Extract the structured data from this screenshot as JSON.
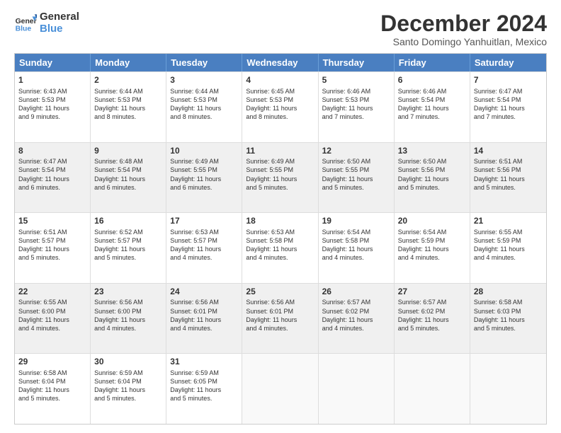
{
  "logo": {
    "line1": "General",
    "line2": "Blue"
  },
  "title": "December 2024",
  "subtitle": "Santo Domingo Yanhuitlan, Mexico",
  "days": [
    "Sunday",
    "Monday",
    "Tuesday",
    "Wednesday",
    "Thursday",
    "Friday",
    "Saturday"
  ],
  "rows": [
    [
      {
        "num": "1",
        "rise": "6:43 AM",
        "set": "5:53 PM",
        "daylight": "11 hours and 9 minutes."
      },
      {
        "num": "2",
        "rise": "6:44 AM",
        "set": "5:53 PM",
        "daylight": "11 hours and 8 minutes."
      },
      {
        "num": "3",
        "rise": "6:44 AM",
        "set": "5:53 PM",
        "daylight": "11 hours and 8 minutes."
      },
      {
        "num": "4",
        "rise": "6:45 AM",
        "set": "5:53 PM",
        "daylight": "11 hours and 8 minutes."
      },
      {
        "num": "5",
        "rise": "6:46 AM",
        "set": "5:53 PM",
        "daylight": "11 hours and 7 minutes."
      },
      {
        "num": "6",
        "rise": "6:46 AM",
        "set": "5:54 PM",
        "daylight": "11 hours and 7 minutes."
      },
      {
        "num": "7",
        "rise": "6:47 AM",
        "set": "5:54 PM",
        "daylight": "11 hours and 7 minutes."
      }
    ],
    [
      {
        "num": "8",
        "rise": "6:47 AM",
        "set": "5:54 PM",
        "daylight": "11 hours and 6 minutes."
      },
      {
        "num": "9",
        "rise": "6:48 AM",
        "set": "5:54 PM",
        "daylight": "11 hours and 6 minutes."
      },
      {
        "num": "10",
        "rise": "6:49 AM",
        "set": "5:55 PM",
        "daylight": "11 hours and 6 minutes."
      },
      {
        "num": "11",
        "rise": "6:49 AM",
        "set": "5:55 PM",
        "daylight": "11 hours and 5 minutes."
      },
      {
        "num": "12",
        "rise": "6:50 AM",
        "set": "5:55 PM",
        "daylight": "11 hours and 5 minutes."
      },
      {
        "num": "13",
        "rise": "6:50 AM",
        "set": "5:56 PM",
        "daylight": "11 hours and 5 minutes."
      },
      {
        "num": "14",
        "rise": "6:51 AM",
        "set": "5:56 PM",
        "daylight": "11 hours and 5 minutes."
      }
    ],
    [
      {
        "num": "15",
        "rise": "6:51 AM",
        "set": "5:57 PM",
        "daylight": "11 hours and 5 minutes."
      },
      {
        "num": "16",
        "rise": "6:52 AM",
        "set": "5:57 PM",
        "daylight": "11 hours and 5 minutes."
      },
      {
        "num": "17",
        "rise": "6:53 AM",
        "set": "5:57 PM",
        "daylight": "11 hours and 4 minutes."
      },
      {
        "num": "18",
        "rise": "6:53 AM",
        "set": "5:58 PM",
        "daylight": "11 hours and 4 minutes."
      },
      {
        "num": "19",
        "rise": "6:54 AM",
        "set": "5:58 PM",
        "daylight": "11 hours and 4 minutes."
      },
      {
        "num": "20",
        "rise": "6:54 AM",
        "set": "5:59 PM",
        "daylight": "11 hours and 4 minutes."
      },
      {
        "num": "21",
        "rise": "6:55 AM",
        "set": "5:59 PM",
        "daylight": "11 hours and 4 minutes."
      }
    ],
    [
      {
        "num": "22",
        "rise": "6:55 AM",
        "set": "6:00 PM",
        "daylight": "11 hours and 4 minutes."
      },
      {
        "num": "23",
        "rise": "6:56 AM",
        "set": "6:00 PM",
        "daylight": "11 hours and 4 minutes."
      },
      {
        "num": "24",
        "rise": "6:56 AM",
        "set": "6:01 PM",
        "daylight": "11 hours and 4 minutes."
      },
      {
        "num": "25",
        "rise": "6:56 AM",
        "set": "6:01 PM",
        "daylight": "11 hours and 4 minutes."
      },
      {
        "num": "26",
        "rise": "6:57 AM",
        "set": "6:02 PM",
        "daylight": "11 hours and 4 minutes."
      },
      {
        "num": "27",
        "rise": "6:57 AM",
        "set": "6:02 PM",
        "daylight": "11 hours and 5 minutes."
      },
      {
        "num": "28",
        "rise": "6:58 AM",
        "set": "6:03 PM",
        "daylight": "11 hours and 5 minutes."
      }
    ],
    [
      {
        "num": "29",
        "rise": "6:58 AM",
        "set": "6:04 PM",
        "daylight": "11 hours and 5 minutes."
      },
      {
        "num": "30",
        "rise": "6:59 AM",
        "set": "6:04 PM",
        "daylight": "11 hours and 5 minutes."
      },
      {
        "num": "31",
        "rise": "6:59 AM",
        "set": "6:05 PM",
        "daylight": "11 hours and 5 minutes."
      },
      null,
      null,
      null,
      null
    ]
  ]
}
